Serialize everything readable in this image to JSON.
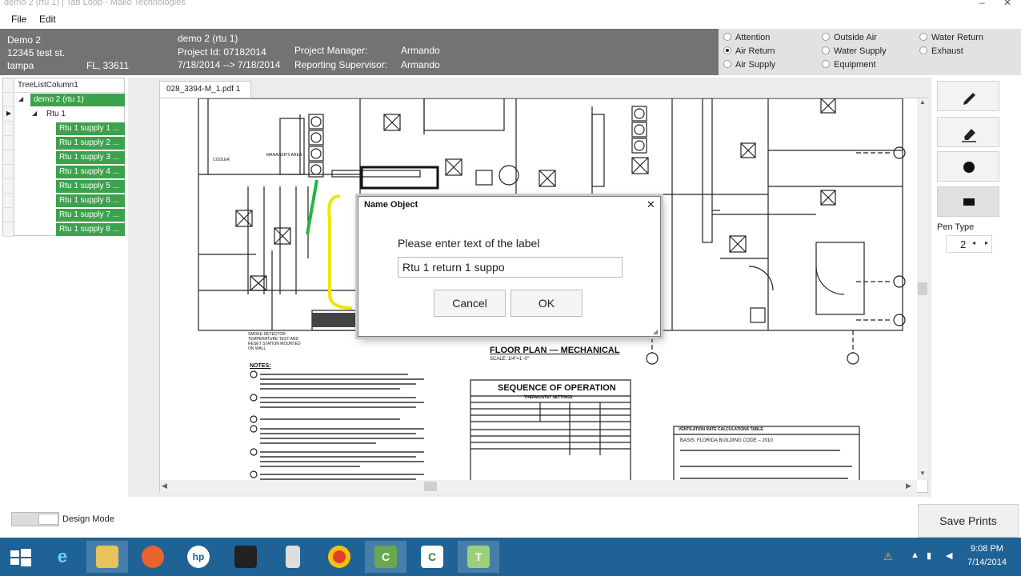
{
  "window": {
    "title": "demo 2 (rtu 1) | Tab Loop - Mako Technologies",
    "minimize": "–",
    "close": "✕"
  },
  "menu": {
    "file": "File",
    "edit": "Edit"
  },
  "header": {
    "client_name": "Demo 2",
    "street": "12345 test st.",
    "city": "tampa",
    "state_zip": "FL,    33611",
    "project_name": "demo 2 (rtu 1)",
    "project_id": "Project Id: 07182014",
    "date_range": "7/18/2014 --> 7/18/2014",
    "pm_label": "Project Manager:",
    "pm_value": "Armando",
    "rs_label": "Reporting Supervisor:",
    "rs_value": "Armando"
  },
  "legend": {
    "items": [
      {
        "label": "Attention",
        "selected": false
      },
      {
        "label": "Outside Air",
        "selected": false
      },
      {
        "label": "Water Return",
        "selected": false
      },
      {
        "label": "Air Return",
        "selected": true
      },
      {
        "label": "Water Supply",
        "selected": false
      },
      {
        "label": "Exhaust",
        "selected": false
      },
      {
        "label": "Air Supply",
        "selected": false
      },
      {
        "label": "Equipment",
        "selected": false
      }
    ]
  },
  "tree": {
    "column_header": "TreeListColumn1",
    "root": "demo 2 (rtu 1)",
    "child": "Rtu 1",
    "items": [
      "Rtu 1 supply 1 ...",
      "Rtu 1 supply 2 ...",
      "Rtu 1 supply 3 ...",
      "Rtu 1 supply 4 ...",
      "Rtu 1 supply 5 ...",
      "Rtu 1 supply 6 ...",
      "Rtu 1 supply 7 ...",
      "Rtu 1 supply 8 ..."
    ],
    "accent": "#3da24d"
  },
  "document": {
    "tab_label": "028_3394-M_1.pdf 1",
    "close_glyph": "✕",
    "plan_title": "FLOOR PLAN — MECHANICAL",
    "plan_scale": "SCALE: 1/4\"=1'-0\"",
    "notes_title": "NOTES:",
    "sequence_title": "SEQUENCE OF OPERATION",
    "thermostat_title": "THERMOSTAT SETTINGS",
    "ventilation_title": "VENTILATION RATE CALCULATIONS TABLE",
    "ventilation_basis": "BASIS: FLORIDA BUILDING CODE – 2010",
    "smoke_note": "SMOKE DETECTOR TEMPERATURE TEST AND RESET STATION MOUNTED ON WALL",
    "cooler_label": "COOLER",
    "managers_label": "MANAGER'S AREA"
  },
  "tools": {
    "pen_type_label": "Pen Type",
    "pen_type_value": "2"
  },
  "bottom": {
    "design_mode_label": "Design Mode",
    "save_prints": "Save Prints"
  },
  "dialog": {
    "title": "Name Object",
    "close": "✕",
    "prompt": "Please enter text of the label",
    "input_value": "Rtu 1 return 1 suppo",
    "cancel": "Cancel",
    "ok": "OK"
  },
  "taskbar": {
    "time": "9:08 PM",
    "date": "7/14/2014",
    "color": "#1f6296"
  }
}
